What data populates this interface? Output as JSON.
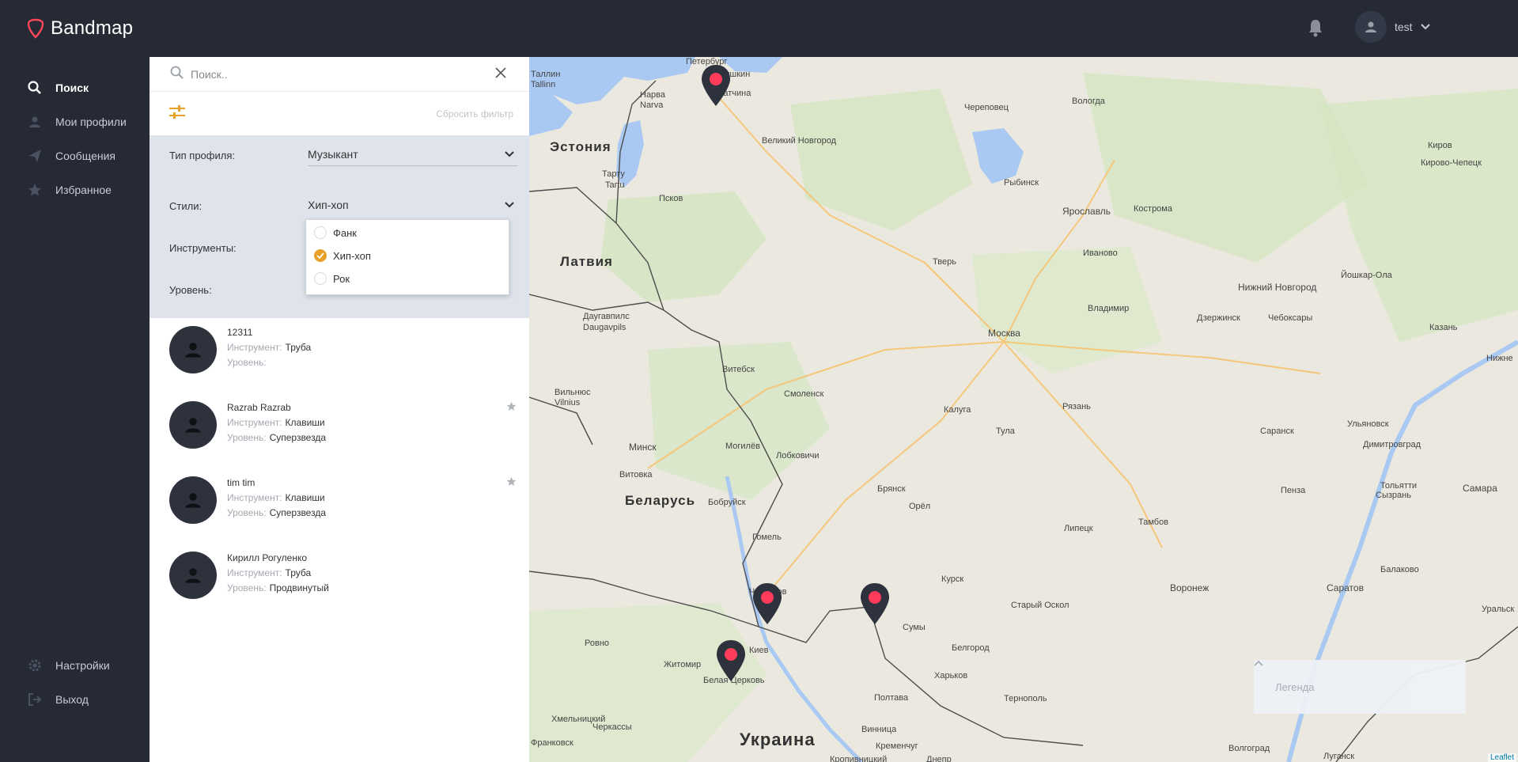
{
  "app": {
    "title": "Bandmap"
  },
  "header": {
    "user_name": "test",
    "icons": [
      "bell-icon",
      "user-icon",
      "chevron-down-icon"
    ]
  },
  "colors": {
    "accent": "#e8a128",
    "brand_red": "#ff4757",
    "sidebar_bg": "#252a35",
    "filter_bg": "#dfe4ec",
    "marker_dark": "#2d323c"
  },
  "sidebar": {
    "items": [
      {
        "label": "Поиск",
        "icon": "search-icon",
        "active": true
      },
      {
        "label": "Мои профили",
        "icon": "user-icon"
      },
      {
        "label": "Сообщения",
        "icon": "send-icon"
      },
      {
        "label": "Избранное",
        "icon": "star-icon"
      }
    ],
    "bottom": [
      {
        "label": "Настройки",
        "icon": "gear-icon"
      },
      {
        "label": "Выход",
        "icon": "logout-icon"
      }
    ]
  },
  "search": {
    "placeholder": "Поиск..",
    "value": ""
  },
  "filter": {
    "reset_label": "Сбросить фильтр",
    "profile_type_label": "Тип профиля:",
    "profile_type_value": "Музыкант",
    "styles_label": "Стили:",
    "styles_value": "Хип-хоп",
    "instruments_label": "Инструменты:",
    "level_label": "Уровень:",
    "style_options": [
      {
        "label": "Фанк",
        "checked": false
      },
      {
        "label": "Хип-хоп",
        "checked": true
      },
      {
        "label": "Рок",
        "checked": false
      }
    ]
  },
  "results": {
    "instrument_label": "Инструмент:",
    "level_label": "Уровень:",
    "items": [
      {
        "name": "12311",
        "instrument": "Труба",
        "level": "",
        "favorite": false
      },
      {
        "name": "Razrab Razrab",
        "instrument": "Клавиши",
        "level": "Суперзвезда",
        "favorite": true
      },
      {
        "name": "tim tim",
        "instrument": "Клавиши",
        "level": "Суперзвезда",
        "favorite": true
      },
      {
        "name": "Кирилл Рогуленко",
        "instrument": "Труба",
        "level": "Продвинутый",
        "favorite": false
      }
    ]
  },
  "map": {
    "legend_label": "Легенда",
    "attribution": "Leaflet",
    "countries": [
      "Эстония",
      "Латвия",
      "Беларусь",
      "Украина"
    ],
    "cities": [
      "Петербург",
      "Пушкин",
      "Таллин",
      "Tallinn",
      "Нарва",
      "Narva",
      "Гатчина",
      "Череповец",
      "Вологда",
      "Киров",
      "Кирово-Чепецк",
      "Великий Новгород",
      "Тарту",
      "Tartu",
      "Псков",
      "Рыбинск",
      "Ярославль",
      "Кострома",
      "Тверь",
      "Иваново",
      "Нижний Новгород",
      "Йошкар-Ола",
      "Москва",
      "Владимир",
      "Дзержинск",
      "Чебоксары",
      "Казань",
      "Даугавпилс",
      "Daugavpils",
      "Витебск",
      "Смоленск",
      "Вильнюс",
      "Vilnius",
      "Калуга",
      "Рязань",
      "Тула",
      "Саранск",
      "Ульяновск",
      "Димитровград",
      "Минск",
      "Могилёв",
      "Лобковичи",
      "Витовка",
      "Брянск",
      "Тольятти",
      "Самара",
      "Бобруйск",
      "Орёл",
      "Пенза",
      "Сызрань",
      "Тамбов",
      "Липецк",
      "Гомель",
      "Чернигов",
      "Воронеж",
      "Курск",
      "Саратов",
      "Балаково",
      "Старый Оскол",
      "Ровно",
      "Житомир",
      "Киев",
      "Сумы",
      "Белгород",
      "Харьков",
      "Белая Церковь",
      "Полтава",
      "Тернополь",
      "Хмельницкий",
      "Винница",
      "Черкассы",
      "Кременчуг",
      "Франковск",
      "Волгоград",
      "Луганск",
      "Днепр",
      "Кропивницкий",
      "Уральск",
      "Нижне"
    ],
    "markers": 4
  }
}
